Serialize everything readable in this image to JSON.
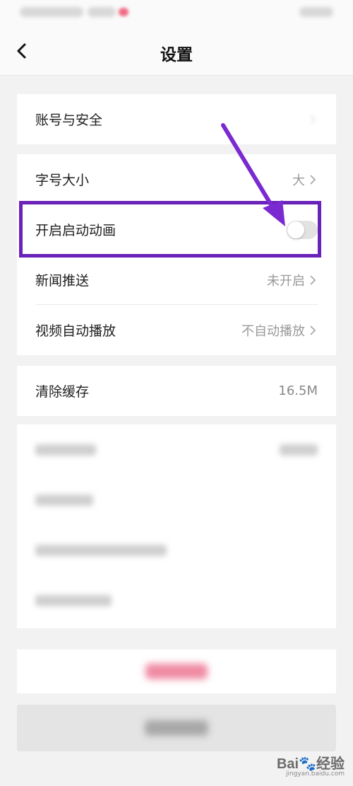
{
  "header": {
    "title": "设置"
  },
  "group1": {
    "items": [
      {
        "label": "账号与安全"
      }
    ]
  },
  "group2": {
    "items": [
      {
        "label": "字号大小",
        "value": "大"
      },
      {
        "label": "开启启动动画",
        "toggle": "off"
      },
      {
        "label": "新闻推送",
        "value": "未开启"
      },
      {
        "label": "视频自动播放",
        "value": "不自动播放"
      }
    ]
  },
  "group3": {
    "items": [
      {
        "label": "清除缓存",
        "value": "16.5M"
      }
    ]
  },
  "annotation": {
    "highlight_color": "#6a22b8"
  },
  "watermark": {
    "brand": "Bai",
    "brand_suffix": "经验",
    "url": "jingyan.baidu.com"
  }
}
